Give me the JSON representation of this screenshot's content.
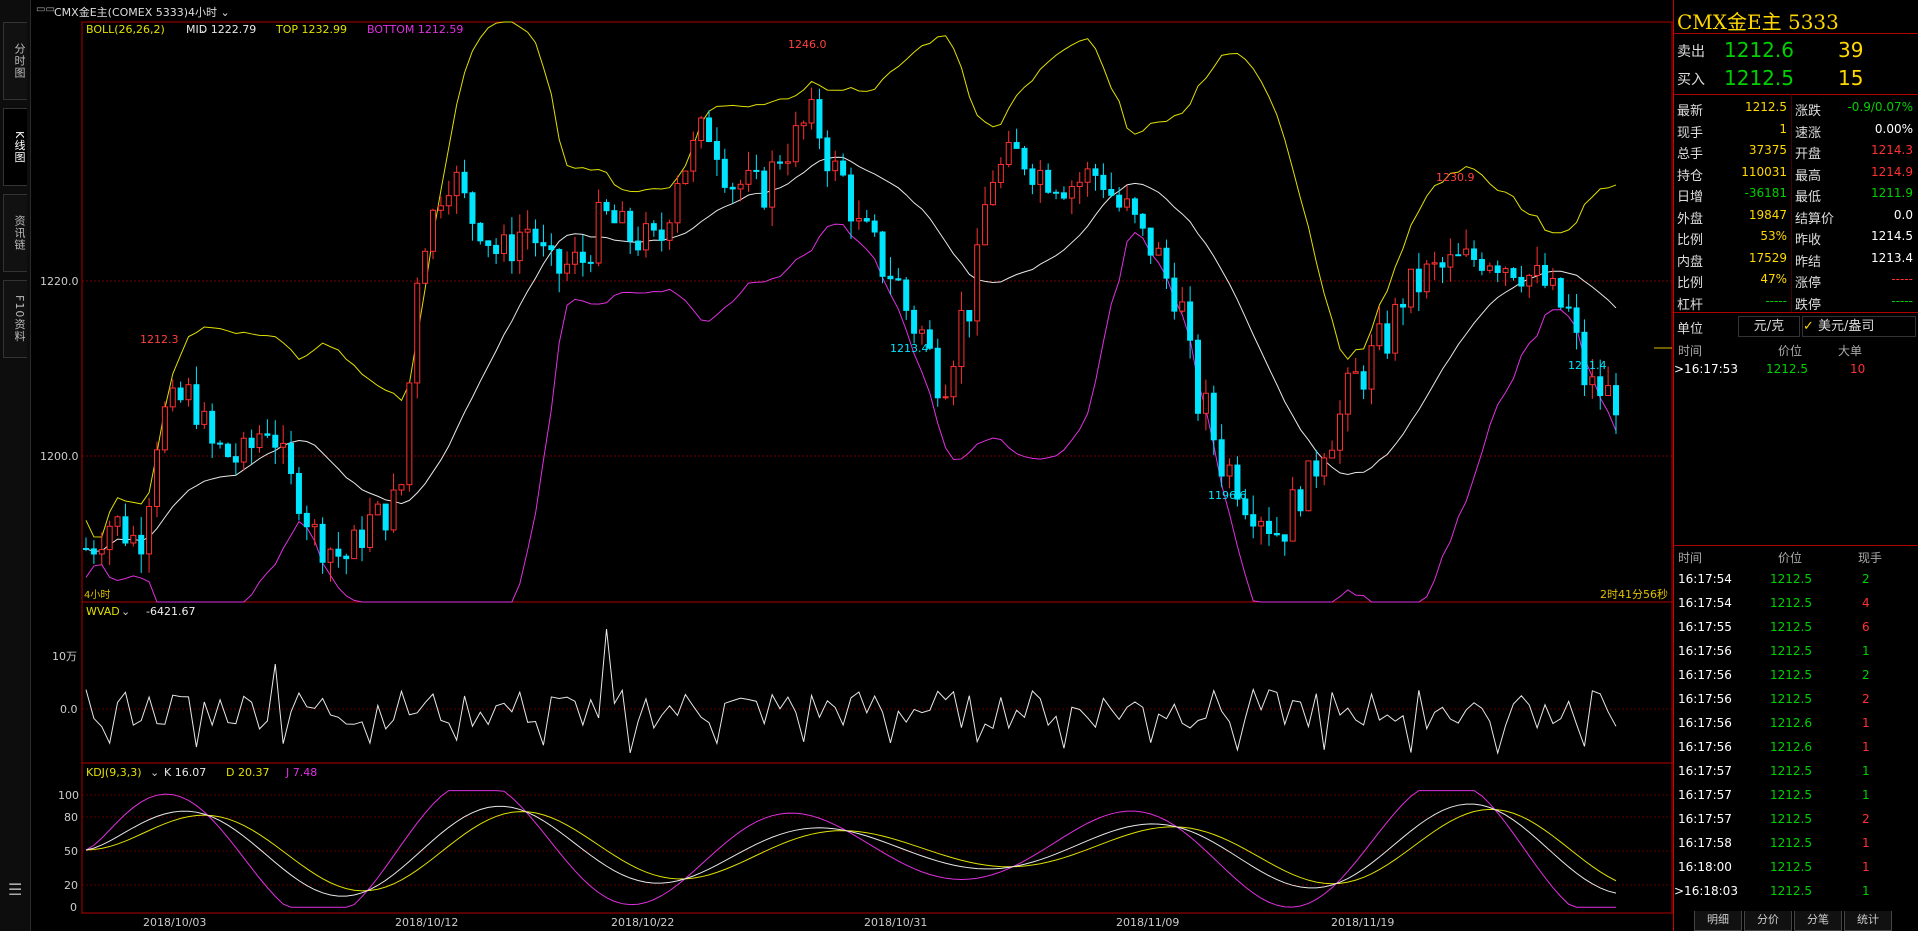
{
  "window": {
    "title": "CMX金E主(COMEX 5333)",
    "period": "4小时"
  },
  "left_tabs": [
    "分时图",
    "K线图",
    "资讯链",
    "F10资料"
  ],
  "main_chart": {
    "indicator_name": "BOLL(26,26,2)",
    "mid_label": "MID 1222.79",
    "top_label": "TOP 1232.99",
    "bottom_label": "BOTTOM 1212.59",
    "price_ticks": [
      "1220.0",
      "1200.0"
    ],
    "annotations": {
      "a1": "1212.3",
      "a2": "1246.0",
      "a3": "1213.4",
      "a4": "1196.6",
      "a5": "1230.9",
      "a6": "1211.4"
    },
    "countdown": "2时41分56秒",
    "corner_label": "4小时"
  },
  "wvad_panel": {
    "label": "WVAD",
    "value": "-6421.67",
    "ticks": [
      "10万",
      "0.0"
    ]
  },
  "kdj_panel": {
    "label": "KDJ(9,3,3)",
    "k": "K 16.07",
    "d": "D 20.37",
    "j": "J 7.48",
    "ticks": [
      "100",
      "80",
      "50",
      "20",
      "0"
    ]
  },
  "x_axis": {
    "dates": [
      "2018/10/03",
      "2018/10/12",
      "2018/10/22",
      "2018/10/31",
      "2018/11/09",
      "2018/11/19"
    ]
  },
  "chart_data": {
    "type": "candlestick",
    "price_range": [
      1189,
      1254
    ],
    "sample_prices_approx": [
      1195,
      1198,
      1196,
      1210,
      1212,
      1206,
      1205,
      1209,
      1202,
      1196,
      1194,
      1198,
      1200,
      1230,
      1237,
      1232,
      1228,
      1231,
      1226,
      1227,
      1232,
      1230,
      1229,
      1238,
      1242,
      1236,
      1235,
      1240,
      1243,
      1237,
      1230,
      1226,
      1220,
      1214,
      1222,
      1237,
      1239,
      1237,
      1236,
      1237,
      1233,
      1229,
      1224,
      1211,
      1204,
      1200,
      1197,
      1202,
      1208,
      1214,
      1218,
      1224,
      1226,
      1227,
      1228,
      1227,
      1225,
      1222,
      1213,
      1212
    ]
  },
  "quote": {
    "title": "CMX金E主  5333",
    "sell_label": "卖出",
    "sell_price": "1212.6",
    "sell_vol": "39",
    "buy_label": "买入",
    "buy_price": "1212.5",
    "buy_vol": "15",
    "rows": [
      {
        "l1": "最新",
        "v1": "1212.5",
        "l2": "涨跌",
        "v2": "-0.9/0.07%"
      },
      {
        "l1": "现手",
        "v1": "1",
        "l2": "速涨",
        "v2": "0.00%"
      },
      {
        "l1": "总手",
        "v1": "37375",
        "l2": "开盘",
        "v2": "1214.3"
      },
      {
        "l1": "持仓",
        "v1": "110031",
        "l2": "最高",
        "v2": "1214.9"
      },
      {
        "l1": "日增",
        "v1": "-36181",
        "l2": "最低",
        "v2": "1211.9"
      },
      {
        "l1": "外盘",
        "v1": "19847",
        "l2": "结算价",
        "v2": "0.0"
      },
      {
        "l1": "比例",
        "v1": "53%",
        "l2": "昨收",
        "v2": "1214.5"
      },
      {
        "l1": "内盘",
        "v1": "17529",
        "l2": "昨结",
        "v2": "1213.4"
      },
      {
        "l1": "比例",
        "v1": "47%",
        "l2": "涨停",
        "v2": "-----"
      },
      {
        "l1": "杠杆",
        "v1": "-----",
        "l2": "跌停",
        "v2": "-----"
      }
    ],
    "unit_label": "单位",
    "unit_opt1": "元/克",
    "unit_opt2": "美元/盎司"
  },
  "big_orders": {
    "headers": [
      "时间",
      "价位",
      "大单"
    ],
    "rows": [
      {
        "time": ">16:17:53",
        "price": "1212.5",
        "vol": "10"
      }
    ]
  },
  "ticks": {
    "headers": [
      "时间",
      "价位",
      "现手"
    ],
    "rows": [
      {
        "time": "16:17:54",
        "price": "1212.5",
        "vol": "2"
      },
      {
        "time": "16:17:54",
        "price": "1212.5",
        "vol": "4"
      },
      {
        "time": "16:17:55",
        "price": "1212.5",
        "vol": "6"
      },
      {
        "time": "16:17:56",
        "price": "1212.5",
        "vol": "1"
      },
      {
        "time": "16:17:56",
        "price": "1212.5",
        "vol": "2"
      },
      {
        "time": "16:17:56",
        "price": "1212.5",
        "vol": "2"
      },
      {
        "time": "16:17:56",
        "price": "1212.6",
        "vol": "1"
      },
      {
        "time": "16:17:56",
        "price": "1212.6",
        "vol": "1"
      },
      {
        "time": "16:17:57",
        "price": "1212.5",
        "vol": "1"
      },
      {
        "time": "16:17:57",
        "price": "1212.5",
        "vol": "1"
      },
      {
        "time": "16:17:57",
        "price": "1212.5",
        "vol": "2"
      },
      {
        "time": "16:17:58",
        "price": "1212.5",
        "vol": "1"
      },
      {
        "time": "16:18:00",
        "price": "1212.5",
        "vol": "1"
      },
      {
        "time": ">16:18:03",
        "price": "1212.5",
        "vol": "1"
      }
    ]
  },
  "bottom_tabs": [
    "明细",
    "分价",
    "分笔",
    "统计"
  ],
  "colors": {
    "up": "#ff3030",
    "down": "#00e5ff",
    "mid": "#e8e8e8",
    "top": "#e0e000",
    "bottom": "#e030e0",
    "grid": "#8b0000"
  }
}
